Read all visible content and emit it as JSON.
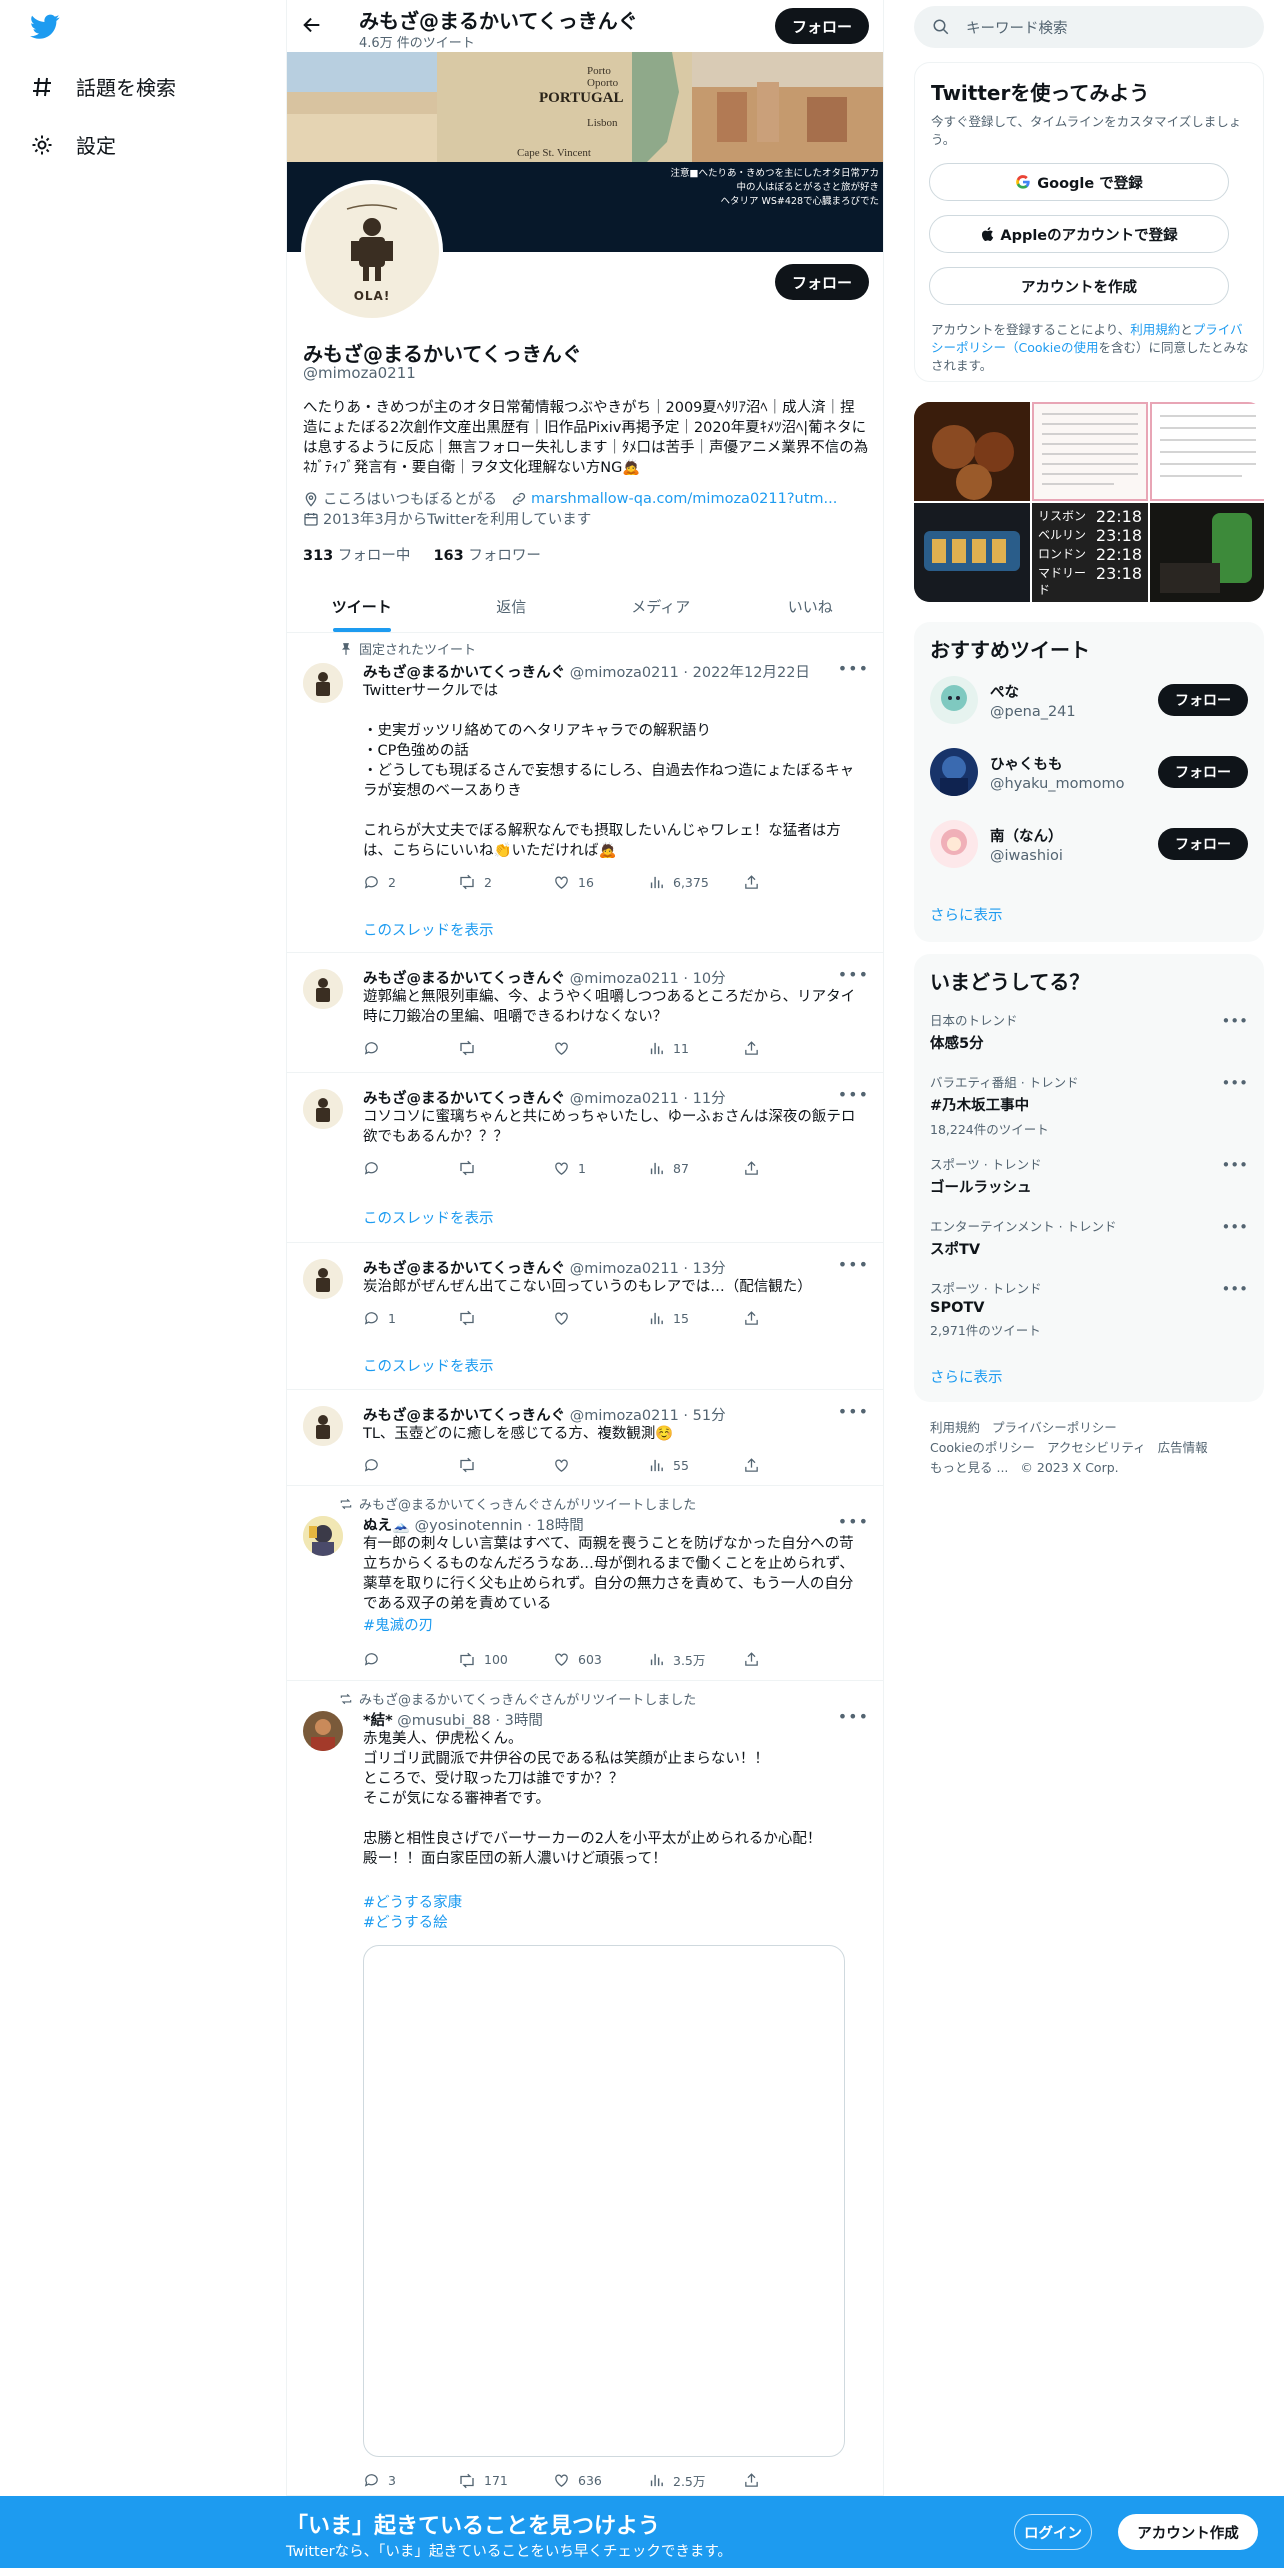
{
  "nav": {
    "explore": "話題を検索",
    "settings": "設定"
  },
  "header": {
    "name": "みもざ@まるかいてくっきんぐ",
    "tweet_count": "4.6万 件のツイート",
    "follow": "フォロー"
  },
  "banner": {
    "map_labels": [
      "Porto",
      "Oporto",
      "PORTUGAL",
      "Lisbon",
      "Cape St. Vincent"
    ],
    "text": "注意■へたりあ・きめつを主にしたオタ日常アカ\n中の人はぼるとがるさと旅が好き\nヘタリア WS#428で心臓まろびでた"
  },
  "profile": {
    "avatar_text": "OLA!",
    "name": "みもざ@まるかいてくっきんぐ",
    "handle": "@mimoza0211",
    "bio": "へたりあ・きめつが主のオタ日常葡情報つぶやきがち｜2009夏ﾍﾀﾘｱ沼ﾍ｜成人済｜捏造にょたぼる2次創作文産出黒歴有｜旧作品Pixiv再掲予定｜2020年夏ｷﾒﾂ沼ﾍ|葡ネタには息するように反応｜無言フォロー失礼します｜ﾀﾒ口は苦手｜声優アニメ業界不信の為ﾈｶﾞﾃｨﾌﾞ発言有・要自衛｜ヲタ文化理解ない方NG🙇",
    "location": "こころはいつもぼるとがる",
    "url": "marshmallow-qa.com/mimoza0211?utm...",
    "joined": "2013年3月からTwitterを利用しています",
    "following": "313",
    "following_label": "フォロー中",
    "followers": "163",
    "followers_label": "フォロワー",
    "follow": "フォロー"
  },
  "tabs": [
    "ツイート",
    "返信",
    "メディア",
    "いいね"
  ],
  "tweets": [
    {
      "pinned": "固定されたツイート",
      "name": "みもざ@まるかいてくっきんぐ",
      "meta": "@mimoza0211 · 2022年12月22日",
      "text": "Twitterサークルでは\n\n・史実ガッツリ絡めてのヘタリアキャラでの解釈語り\n・CP色強めの話\n・どうしても現ぼるさんで妄想するにしろ、自過去作ねつ造にょたぼるキャラが妄想のベースありき\n\nこれらが大丈夫でぼる解釈なんでも摂取したいんじゃワレェ！な猛者は方は、こちらにいいね👏いただければ🙇",
      "reply": "2",
      "rt": "2",
      "like": "16",
      "views": "6,375",
      "thread": "このスレッドを表示"
    },
    {
      "name": "みもざ@まるかいてくっきんぐ",
      "meta": "@mimoza0211 · 10分",
      "text": "遊郭編と無限列車編、今、ようやく咀嚼しつつあるところだから、リアタイ時に刀鍛冶の里編、咀嚼できるわけなくない？",
      "reply": "",
      "rt": "",
      "like": "",
      "views": "11"
    },
    {
      "name": "みもざ@まるかいてくっきんぐ",
      "meta": "@mimoza0211 · 11分",
      "text": "コソコソに蜜璃ちゃんと共にめっちゃいたし、ゆーふぉさんは深夜の飯テロ欲でもあるんか？？？",
      "reply": "",
      "rt": "",
      "like": "1",
      "views": "87",
      "thread": "このスレッドを表示"
    },
    {
      "name": "みもざ@まるかいてくっきんぐ",
      "meta": "@mimoza0211 · 13分",
      "text": "炭治郎がぜんぜん出てこない回っていうのもレアでは…（配信観た）",
      "reply": "1",
      "rt": "",
      "like": "",
      "views": "15",
      "thread": "このスレッドを表示"
    },
    {
      "name": "みもざ@まるかいてくっきんぐ",
      "meta": "@mimoza0211 · 51分",
      "text": "TL、玉壺どのに癒しを感じてる方、複数観測☺️",
      "reply": "",
      "rt": "",
      "like": "",
      "views": "55"
    },
    {
      "retweet": "みもざ@まるかいてくっきんぐさんがリツイートしました",
      "name": "ぬえ🗻",
      "meta": "@yosinotennin · 18時間",
      "text": "有一郎の刺々しい言葉はすべて、両親を喪うことを防げなかった自分への苛立ちからくるものなんだろうなあ…母が倒れるまで働くことを止められず、薬草を取りに行く父も止められず。自分の無力さを責めて、もう一人の自分である双子の弟を責めている",
      "hashtag": "#鬼滅の刃",
      "reply": "",
      "rt": "100",
      "like": "603",
      "views": "3.5万"
    },
    {
      "retweet": "みもざ@まるかいてくっきんぐさんがリツイートしました",
      "name": "*結*",
      "meta": "@musubi_88 · 3時間",
      "text": "赤鬼美人、伊虎松くん。\nゴリゴリ武闘派で井伊谷の民である私は笑顔が止まらない！！\nところで、受け取った刀は誰ですか？？\nそこが気になる審神者です。\n\n忠勝と相性良さげでバーサーカーの2人を小平太が止められるか心配！\n殿ー！！面白家臣団の新人濃いけど頑張って！",
      "hashtags": [
        "#どうする家康",
        "#どうする絵"
      ],
      "reply": "3",
      "rt": "171",
      "like": "636",
      "views": "2.5万"
    }
  ],
  "right": {
    "search_placeholder": "キーワード検索",
    "join": {
      "title": "Twitterを使ってみよう",
      "sub": "今すぐ登録して、タイムラインをカスタマイズしましょう。",
      "google": "Google で登録",
      "apple": "Appleのアカウントで登録",
      "create": "アカウントを作成",
      "legal_1": "アカウントを登録することにより、",
      "legal_terms": "利用規約",
      "legal_and": "と",
      "legal_privacy": "プライバシーポリシー",
      "legal_cookie": "（Cookieの使用",
      "legal_2": "を含む）に同意したとみなされます。"
    },
    "media_cities": [
      [
        "リスボン",
        "22:18"
      ],
      [
        "ベルリン",
        "23:18"
      ],
      [
        "ロンドン",
        "22:18"
      ],
      [
        "マドリード",
        "23:18"
      ]
    ],
    "wtf": {
      "title": "おすすめツイート",
      "users": [
        {
          "name": "ぺな",
          "handle": "@pena_241",
          "color": "#7fc9c0"
        },
        {
          "name": "ひゃくもも",
          "handle": "@hyaku_momomo",
          "color": "#2d4f86"
        },
        {
          "name": "南（なん）",
          "handle": "@iwashioi",
          "color": "#f0b0b8"
        }
      ],
      "follow": "フォロー",
      "more": "さらに表示"
    },
    "trends": {
      "title": "いまどうしてる？",
      "items": [
        {
          "ctx": "日本のトレンド",
          "name": "体感5分",
          "count": ""
        },
        {
          "ctx": "バラエティ番組 · トレンド",
          "name": "#乃木坂工事中",
          "count": "18,224件のツイート"
        },
        {
          "ctx": "スポーツ · トレンド",
          "name": "ゴールラッシュ",
          "count": ""
        },
        {
          "ctx": "エンターテインメント · トレンド",
          "name": "スポTV",
          "count": ""
        },
        {
          "ctx": "スポーツ · トレンド",
          "name": "SPOTV",
          "count": "2,971件のツイート"
        }
      ],
      "more": "さらに表示"
    },
    "footer": [
      "利用規約",
      "プライバシーポリシー",
      "Cookieのポリシー",
      "アクセシビリティ",
      "広告情報",
      "もっと見る ...",
      "© 2023 X Corp."
    ]
  },
  "bottom": {
    "title": "「いま」起きていることを見つけよう",
    "sub": "Twitterなら、「いま」起きていることをいち早くチェックできます。",
    "login": "ログイン",
    "signup": "アカウント作成"
  },
  "colors": {
    "accent": "#1d9bf0",
    "dark": "#0f1419",
    "gray": "#536471"
  }
}
